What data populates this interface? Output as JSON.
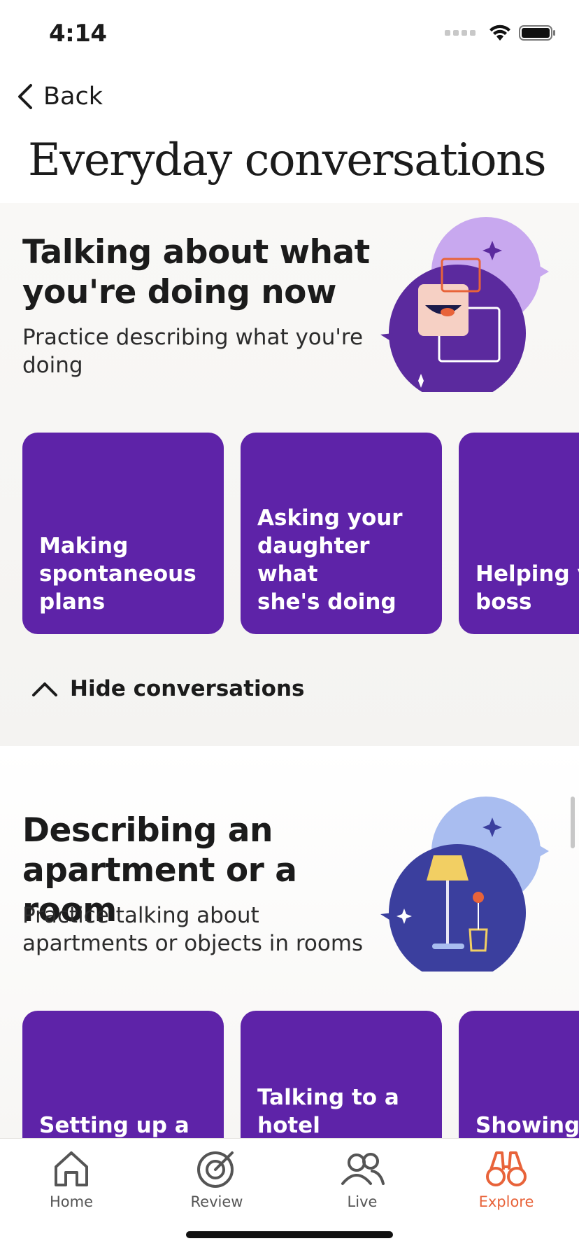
{
  "status_bar": {
    "time": "4:14"
  },
  "nav": {
    "back_label": "Back"
  },
  "page": {
    "title": "Everyday conversations"
  },
  "sections": [
    {
      "heading": "Talking about what you're doing now",
      "description": "Practice describing what you're doing",
      "cards": [
        {
          "label": "Making\nspontaneous\nplans"
        },
        {
          "label": "Asking your\ndaughter what\nshe's doing"
        },
        {
          "label": "Helping y\nboss"
        }
      ],
      "toggle_label": "Hide conversations",
      "illustration": "chat-bubbles-illustration",
      "accent_color": "#5b2a9e"
    },
    {
      "heading": "Describing an apartment or a room",
      "description": "Practice talking about apartments or objects in rooms",
      "cards": [
        {
          "label": "Setting up a"
        },
        {
          "label": "Talking to a\nhotel"
        },
        {
          "label": "Showing y"
        }
      ],
      "illustration": "lamp-illustration",
      "accent_color": "#3b3f9e"
    }
  ],
  "tab_bar": {
    "tabs": [
      {
        "label": "Home",
        "icon": "home-icon",
        "active": false
      },
      {
        "label": "Review",
        "icon": "target-icon",
        "active": false
      },
      {
        "label": "Live",
        "icon": "people-icon",
        "active": false
      },
      {
        "label": "Explore",
        "icon": "binoculars-icon",
        "active": true
      }
    ]
  },
  "colors": {
    "card": "#5e23a8",
    "active_tab": "#e8633a",
    "inactive_tab": "#555555"
  }
}
